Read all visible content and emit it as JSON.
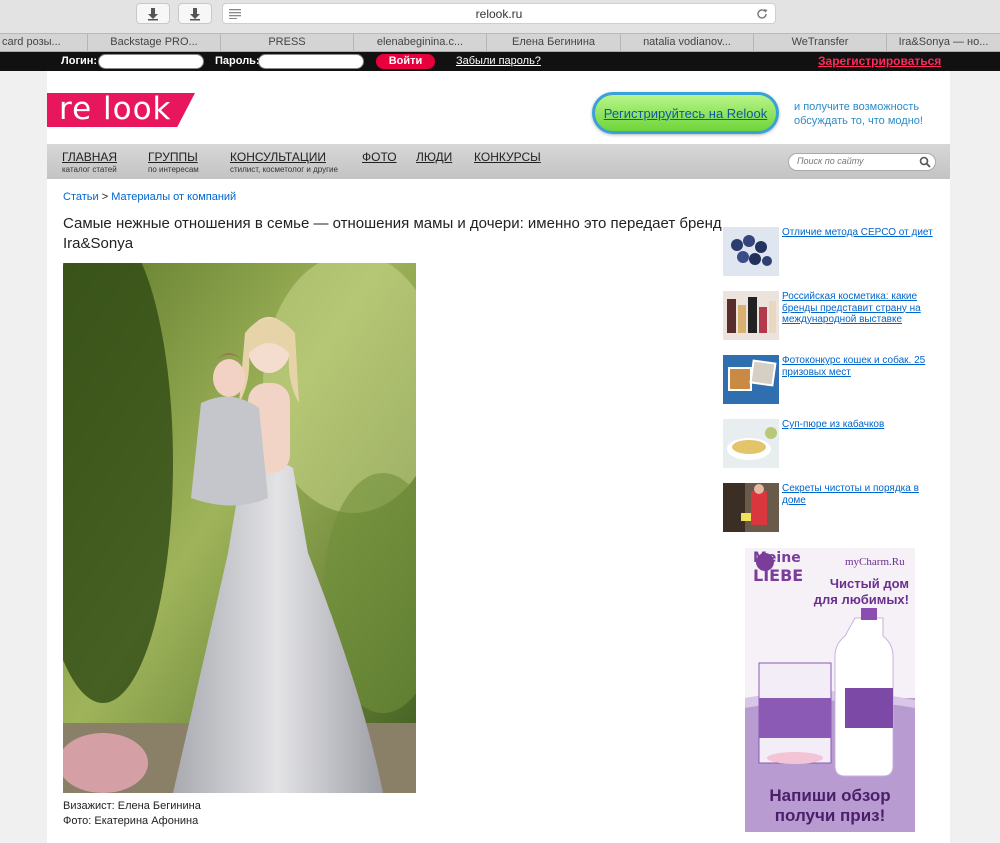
{
  "browser": {
    "url": "relook.ru",
    "tabs": [
      "card розы...",
      "Backstage PRO...",
      "PRESS",
      "elenabeginina.c...",
      "Елена Бегинина",
      "natalia vodianov...",
      "WeTransfer",
      "Ira&Sonya — но..."
    ]
  },
  "login_bar": {
    "login_label": "Логин:",
    "password_label": "Пароль:",
    "enter_label": "Войти",
    "forgot_label": "Забыли пароль?",
    "register_label": "Зарегистрироваться"
  },
  "header": {
    "logo_text": "re look",
    "register_button": "Регистрируйтесь на Relook",
    "register_note": "и получите возможность обсуждать то, что модно!"
  },
  "nav": {
    "items": [
      {
        "title": "ГЛАВНАЯ",
        "sub": "каталог статей"
      },
      {
        "title": "ГРУППЫ",
        "sub": "по интересам"
      },
      {
        "title": "КОНСУЛЬТАЦИИ",
        "sub": "стилист, косметолог и другие"
      },
      {
        "title": "ФОТО",
        "sub": ""
      },
      {
        "title": "ЛЮДИ",
        "sub": ""
      },
      {
        "title": "КОНКУРСЫ",
        "sub": ""
      }
    ],
    "search_placeholder": "Поиск по сайту"
  },
  "breadcrumb": {
    "root": "Статьи",
    "separator": ">",
    "section": "Материалы от компаний"
  },
  "article": {
    "title": "Самые нежные отношения в семье — отношения мамы и дочери: именно это передает бренд Ira&Sonya",
    "caption_1": "Визажист: Елена Бегинина",
    "caption_2": "Фото: Екатерина Афонина"
  },
  "related": [
    {
      "title": "Отличие метода СЕРСО от диет"
    },
    {
      "title": "Российская косметика: какие бренды представит страну на международной выставке"
    },
    {
      "title": "Фотоконкурс кошек и собак. 25 призовых мест"
    },
    {
      "title": "Суп-пюре из кабачков"
    },
    {
      "title": "Секреты чистоты и порядка в доме"
    }
  ],
  "ad": {
    "site": "myCharm.Ru",
    "brand_top": "Meine",
    "brand_bottom": "LIEBE",
    "headline_1": "Чистый дом",
    "headline_2": "для любимых!",
    "cta_1": "Напиши обзор",
    "cta_2": "получи приз!"
  }
}
